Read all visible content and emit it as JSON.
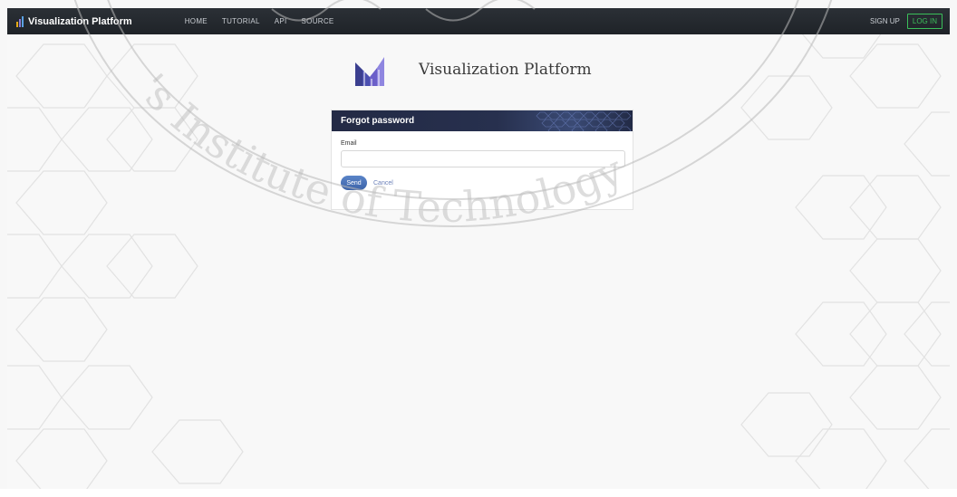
{
  "navbar": {
    "brand": "Visualization Platform",
    "links": [
      "HOME",
      "TUTORIAL",
      "API",
      "SOURCE"
    ],
    "signup": "SIGN UP",
    "login": "LOG IN",
    "accent_login": "#3bbf5a"
  },
  "logo": {
    "title": "Visualization Platform"
  },
  "form": {
    "header": "Forgot password",
    "email_label": "Email",
    "email_value": "",
    "send_label": "Send",
    "cancel_label": "Cancel"
  },
  "watermark": {
    "text": "'s Institute of Technology"
  },
  "colors": {
    "navbar_bg": "#23272c",
    "card_header_bg": "#232a45",
    "send_button": "#4a72b8"
  }
}
